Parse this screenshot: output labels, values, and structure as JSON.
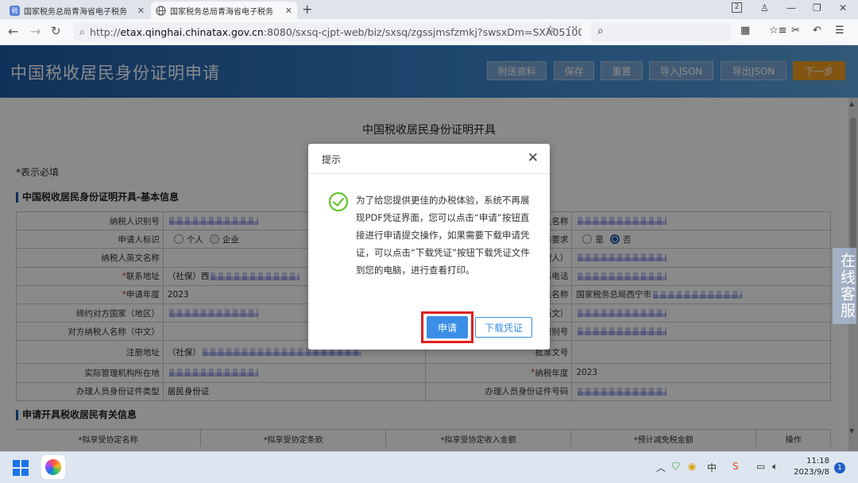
{
  "browser": {
    "tabs": [
      {
        "favicon": "税",
        "title": "国家税务总局青海省电子税务"
      },
      {
        "title": "国家税务总局青海省电子税务"
      }
    ],
    "url_prefix": "http://",
    "url_host": "etax.qinghai.chinatax.gov.cn",
    "url_rest": ":8080/sxsq-cjpt-web/biz/sxsq/zgssjmsfzmkj?swsxDm=SXA05100",
    "tab_badge": "2"
  },
  "header": {
    "title": "中国税收居民身份证明申请",
    "buttons": [
      "附送资料",
      "保存",
      "重置",
      "导入JSON",
      "导出JSON",
      "下一步"
    ]
  },
  "form": {
    "title": "中国税收居民身份证明开具",
    "required_note": "*表示必填",
    "section1_title": "中国税收居民身份证明开具-基本信息",
    "section2_title": "申请开具税收居民有关信息",
    "rows": [
      {
        "l1": "纳税人识别号",
        "v1": "",
        "l2": "纳税人名称",
        "v2": ""
      },
      {
        "l1": "申请人标识",
        "v1": "",
        "l2": "是否有特殊要求",
        "v2": ""
      },
      {
        "l1": "纳税人英文名称",
        "v1": "",
        "l2": "经办人（代理人）",
        "v2": ""
      },
      {
        "l1": "联系地址",
        "v1": "（社保）西",
        "l2": "联系电话",
        "v2": ""
      },
      {
        "l1": "申请年度",
        "v1": "2023",
        "l2": "受理税务机关名称",
        "v2": "国家税务总局西宁市"
      },
      {
        "l1": "缔约对方国家（地区）",
        "v1": "",
        "l2": "纳税人名称（英文）",
        "v2": ""
      },
      {
        "l1": "对方纳税人名称（中文）",
        "v1": "",
        "l2": "对方纳税人识别号",
        "v2": ""
      },
      {
        "l1": "注册地址",
        "v1": "（社保）",
        "l2": "批准文号",
        "v2": ""
      },
      {
        "l1": "实际管理机构所在地",
        "v1": "",
        "l2": "纳税年度",
        "v2": "2023"
      },
      {
        "l1": "办理人员身份证件类型",
        "v1": "居民身份证",
        "l2": "办理人员身份证件号码",
        "v2": ""
      }
    ],
    "applicant_options": [
      "个人",
      "企业"
    ],
    "special_options": [
      "是",
      "否"
    ],
    "subtable_headers": [
      "*拟享受协定名称",
      "*拟享受协定条款",
      "*拟享受协定收入金额",
      "*预计减免税金额",
      "操作"
    ]
  },
  "dialog": {
    "title": "提示",
    "message": "为了给您提供更佳的办税体验，系统不再展现PDF凭证界面，您可以点击“申请”按钮直接进行申请提交操作，如果需要下载申请凭证，可以点击“下载凭证”按钮下载凭证文件到您的电脑，进行查看打印。",
    "apply_label": "申请",
    "download_label": "下载凭证"
  },
  "side_widget": "在线客服",
  "taskbar": {
    "time": "11:18",
    "date": "2023/9/8",
    "ime": "中",
    "notifications": "1"
  },
  "colors": {
    "banner": "#1e5aa6",
    "accent": "#3a8ee6",
    "next": "#f0a020",
    "highlight": "#e01f1f"
  }
}
